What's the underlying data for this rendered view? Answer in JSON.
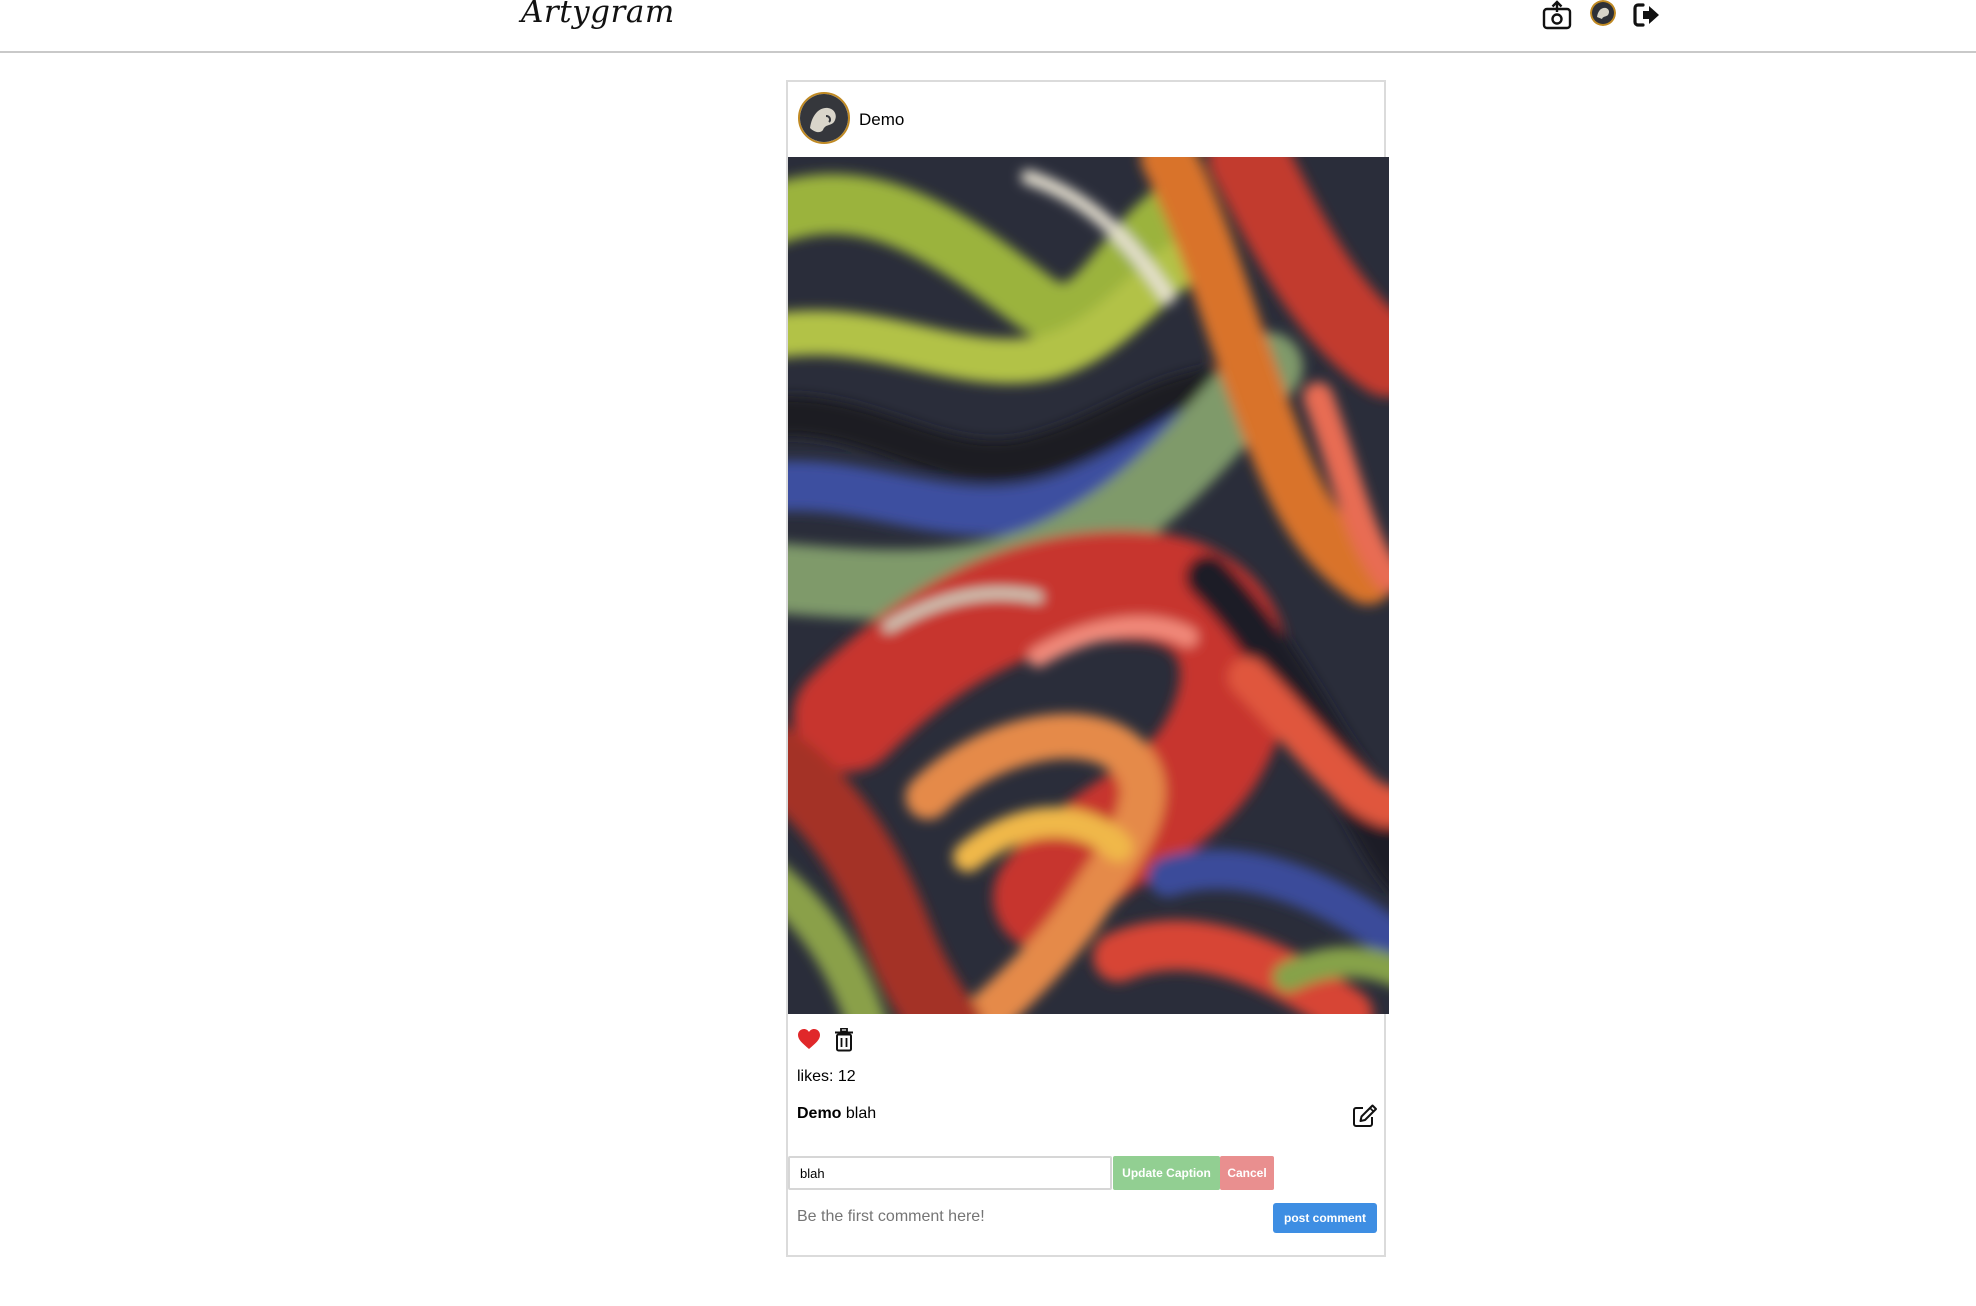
{
  "header": {
    "logo": "Artygram",
    "icons": [
      "upload-photo-icon",
      "profile-avatar",
      "logout-icon"
    ]
  },
  "post": {
    "username": "Demo",
    "likes_text": "likes: 12",
    "liked": true,
    "caption_user": "Demo",
    "caption_text": "blah",
    "edit_caption": {
      "input_value": "blah",
      "update_label": "Update Caption",
      "cancel_label": "Cancel"
    },
    "comment": {
      "placeholder": "Be the first comment here!",
      "post_label": "post comment"
    }
  },
  "colors": {
    "heart": "#e0282a",
    "update_button": "#92cf92",
    "cancel_button": "#e98f8f",
    "post_button": "#3e8ee3",
    "divider": "#c9c9c9",
    "avatar_ring": "#c08a24"
  }
}
